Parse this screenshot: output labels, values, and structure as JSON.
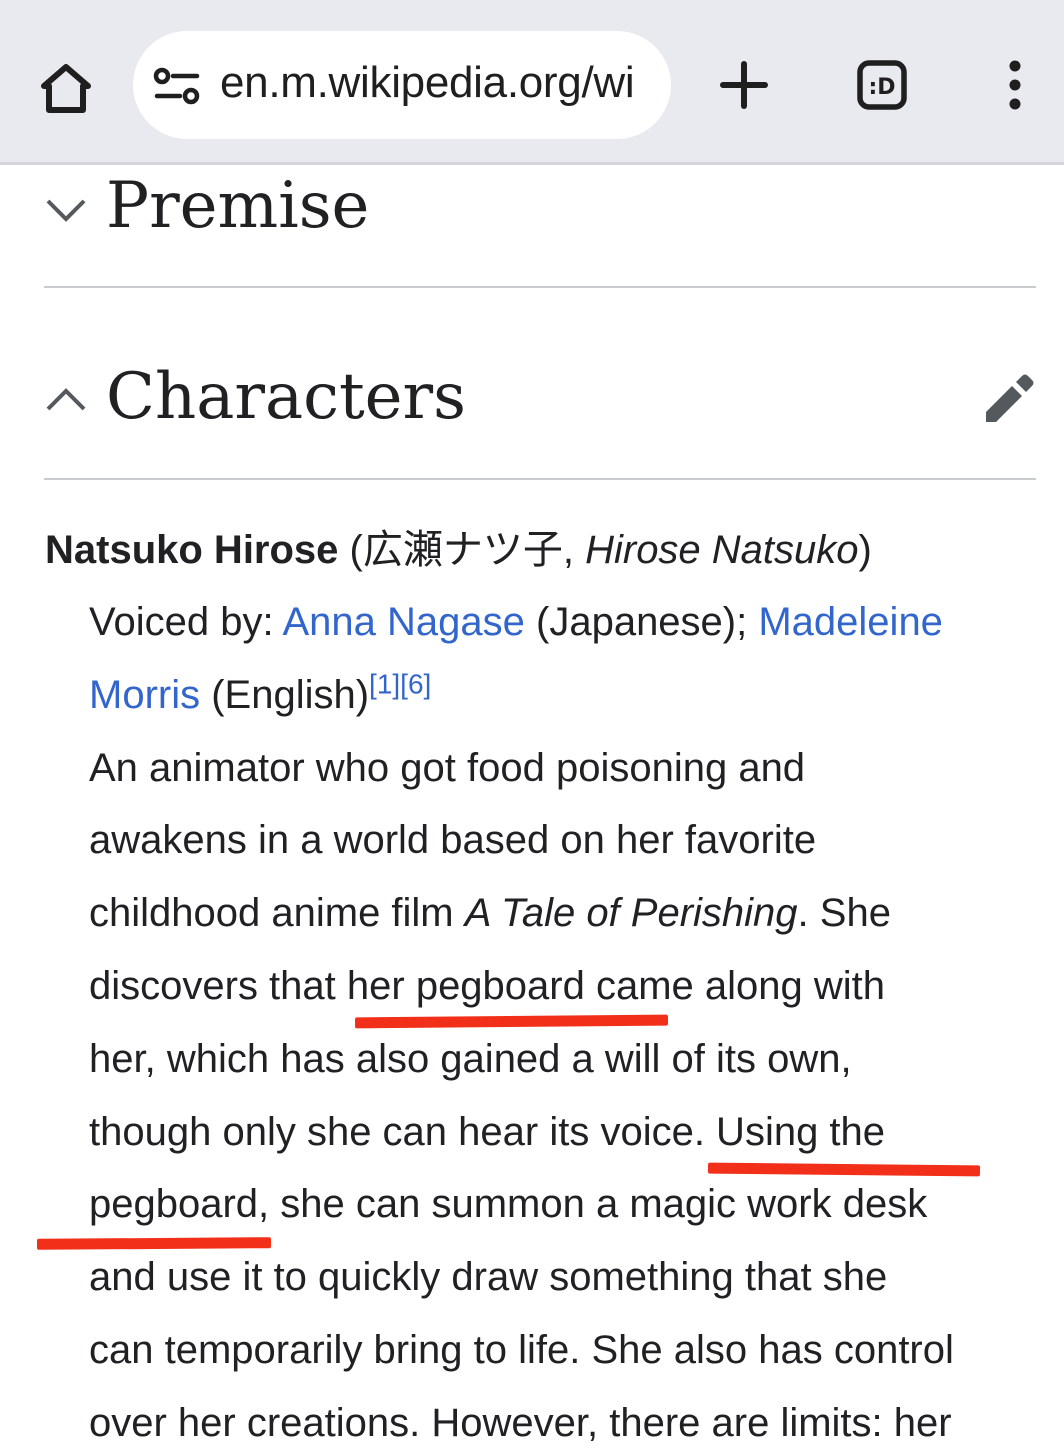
{
  "browser": {
    "url": "en.m.wikipedia.org/wi",
    "icons": [
      "home-icon",
      "site-settings-icon",
      "new-tab-icon",
      "tab-switcher-icon",
      "more-menu-icon"
    ],
    "tab_switcher_label": ":D"
  },
  "sections": {
    "premise": {
      "title": "Premise",
      "state": "collapsed"
    },
    "characters": {
      "title": "Characters",
      "state": "expanded"
    }
  },
  "character": {
    "name": "Natsuko Hirose",
    "paren_open": " (",
    "japanese_name": "広瀬ナツ子",
    "comma": ", ",
    "romaji": "Hirose Natsuko",
    "paren_close": ")",
    "voiced_by_prefix": "Voiced by: ",
    "jp_va": "Anna Nagase",
    "jp_va_suffix": " (Japanese); ",
    "en_va_first": "Madeleine",
    "en_va_second": "Morris",
    "en_va_suffix": " (English)",
    "refs": "[1][6]",
    "description": {
      "line1": "An animator who got food poisoning and",
      "line2": "awakens in a world based on her favorite",
      "line3_before": "childhood anime film ",
      "line3_title": "A Tale of Perishing",
      "line3_after": ". She",
      "line4": "discovers that her pegboard came along with",
      "line5": "her, which has also gained a will of its own,",
      "line6": "though only she can hear its voice. Using the",
      "line7": "pegboard, she can summon a magic work desk",
      "line8": "and use it to quickly draw something that she",
      "line9": "can temporarily bring to life. She also has control",
      "line10": "over her creations. However, there are limits: her"
    }
  },
  "colors": {
    "toolbar_bg": "#e8eaf0",
    "link": "#3366cc",
    "text": "#202122",
    "annotation": "#f2301a"
  }
}
